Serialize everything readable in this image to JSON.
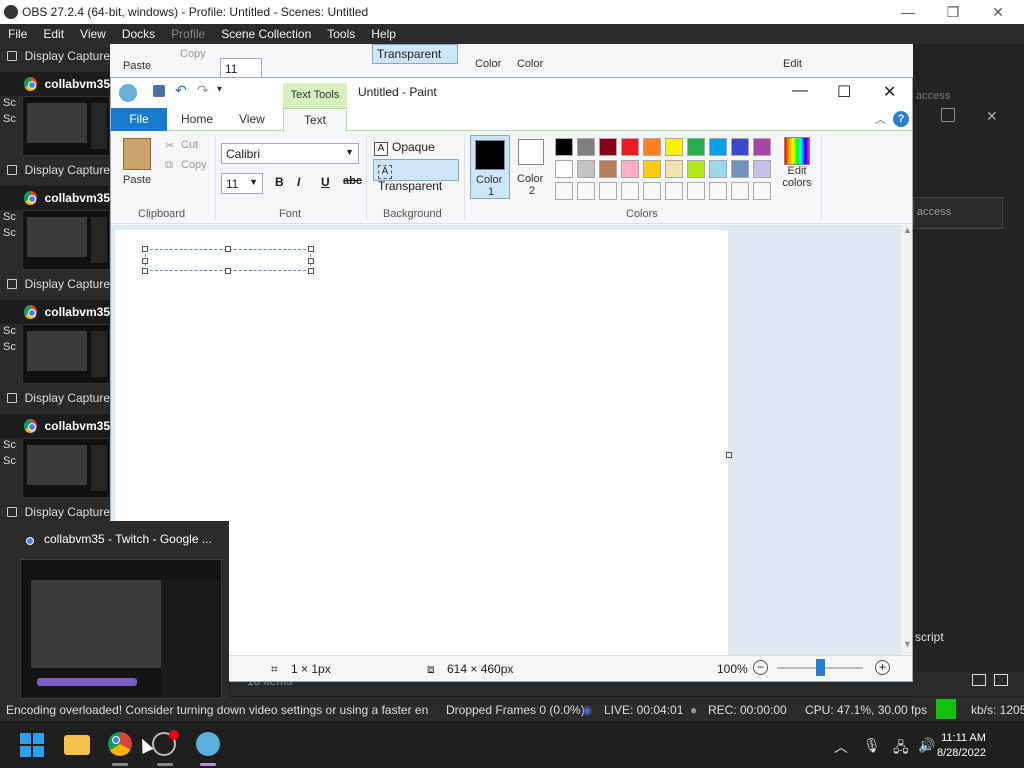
{
  "obs": {
    "title": "OBS 27.2.4 (64-bit, windows) - Profile: Untitled - Scenes: Untitled",
    "window_controls": [
      "—",
      "❐",
      "✕"
    ],
    "menu": [
      "File",
      "Edit",
      "View",
      "Docks",
      "Profile",
      "Scene Collection",
      "Tools",
      "Help"
    ],
    "sources": [
      {
        "label": "Display Capture",
        "type": "display"
      },
      {
        "label": "collabvm35",
        "type": "chrome"
      },
      {
        "label": "Display Capture",
        "type": "display"
      },
      {
        "label": "collabvm35",
        "type": "chrome"
      },
      {
        "label": "Display Capture",
        "type": "display"
      },
      {
        "label": "collabvm35",
        "type": "chrome"
      },
      {
        "label": "Display Capture",
        "type": "display"
      },
      {
        "label": "collabvm35",
        "type": "chrome"
      },
      {
        "label": "Display Capture",
        "type": "display"
      }
    ],
    "scene_fragment": [
      "Sc",
      "Sc"
    ],
    "right_panel": {
      "access_1": "access",
      "access_2": "access",
      "script_label": "script"
    },
    "items_count": "10 items",
    "status": {
      "encoding_warning": "Encoding overloaded! Consider turning down video settings or using a faster en",
      "dropped_frames": "Dropped Frames 0 (0.0%)",
      "live": "LIVE: 00:04:01",
      "rec": "REC: 00:00:00",
      "cpu": "CPU: 47.1%, 30.00 fps",
      "kbps": "kb/s: 1205",
      "indicator_color": "#12c012"
    }
  },
  "paint": {
    "quick_access": [
      "save-icon",
      "undo-icon",
      "redo-icon"
    ],
    "contextual_tab": "Text Tools",
    "title": "Untitled - Paint",
    "controls": [
      "—",
      "☐",
      "✕"
    ],
    "tabs": {
      "file": "File",
      "home": "Home",
      "view": "View",
      "text": "Text"
    },
    "clipboard": {
      "paste": "Paste",
      "cut": "Cut",
      "copy": "Copy",
      "group": "Clipboard"
    },
    "font": {
      "family": "Calibri",
      "size": "11",
      "bold": "B",
      "italic": "I",
      "underline": "U",
      "strike": "abc",
      "group": "Font"
    },
    "background": {
      "opaque": "Opaque",
      "transparent": "Transparent",
      "group": "Background"
    },
    "colors": {
      "color1_label": "Color\n1",
      "color1": "Color",
      "color1_num": "1",
      "color2": "Color",
      "color2_num": "2",
      "edit_line1": "Edit",
      "edit_line2": "colors",
      "group": "Colors",
      "palette_row1": [
        "#000000",
        "#7f7f7f",
        "#880015",
        "#ed1c24",
        "#ff7f27",
        "#fff200",
        "#22b14c",
        "#00a2e8",
        "#3f48cc",
        "#a349a4"
      ],
      "palette_row2": [
        "#ffffff",
        "#c3c3c3",
        "#b97a57",
        "#ffaec9",
        "#ffc90e",
        "#efe4b0",
        "#b5e61d",
        "#99d9ea",
        "#7092be",
        "#c8bfe7"
      ]
    },
    "status": {
      "selection": "1 × 1px",
      "canvas_size": "614 × 460px",
      "zoom": "100%"
    }
  },
  "taskbar": {
    "popup_title": "collabvm35 - Twitch - Google ...",
    "time": "11:11 AM",
    "date": "8/28/2022"
  }
}
